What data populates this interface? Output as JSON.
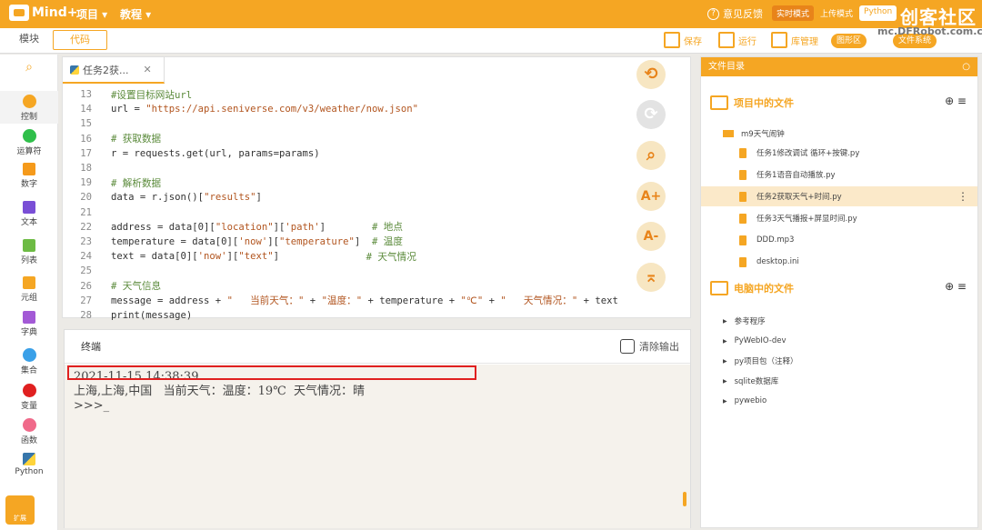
{
  "app": {
    "logo": "Mind+",
    "menu_project": "项目 ▾",
    "menu_tutorial": "教程 ▾",
    "feedback": "意见反馈",
    "modes": [
      "实时模式",
      "上传模式",
      "Python"
    ],
    "brand": "创客社区",
    "site": "mc.DFRobot.com.cn"
  },
  "toolbar": {
    "tab_blocks": "模块",
    "tab_code": "代码",
    "save": "保存",
    "run": "运行",
    "lib": "库管理",
    "graph": "图形区",
    "fs": "文件系统"
  },
  "sidebar": [
    "控制",
    "运算符",
    "数字",
    "文本",
    "列表",
    "元组",
    "字典",
    "集合",
    "变量",
    "函数",
    "Python",
    "扩展"
  ],
  "sidebar_colors": [
    "#f5a623",
    "#2fbf4a",
    "#f59a1b",
    "#7a4fd6",
    "#6dbb44",
    "#f5a623",
    "#a35ad6",
    "#3aa0e8",
    "#e02020",
    "#f06a8a",
    "#3776ab"
  ],
  "editor": {
    "file_tab": "任务2获...",
    "lines": [
      {
        "n": "13",
        "t": [
          [
            "cm",
            "#设置目标网站url"
          ]
        ]
      },
      {
        "n": "14",
        "t": [
          [
            "",
            "url = "
          ],
          [
            "st",
            "\"https://api.seniverse.com/v3/weather/now.json\""
          ]
        ]
      },
      {
        "n": "15",
        "t": []
      },
      {
        "n": "16",
        "t": [
          [
            "cm",
            "# 获取数据"
          ]
        ]
      },
      {
        "n": "17",
        "t": [
          [
            "",
            "r = requests.get(url, params=params)"
          ]
        ]
      },
      {
        "n": "18",
        "t": []
      },
      {
        "n": "19",
        "t": [
          [
            "cm",
            "# 解析数据"
          ]
        ]
      },
      {
        "n": "20",
        "t": [
          [
            "",
            "data = r.json()["
          ],
          [
            "st",
            "\"results\""
          ],
          [
            "",
            "]"
          ]
        ]
      },
      {
        "n": "21",
        "t": []
      },
      {
        "n": "22",
        "t": [
          [
            "",
            "address = data[0]["
          ],
          [
            "st",
            "\"location\""
          ],
          [
            "",
            "]["
          ],
          [
            "st",
            "'path'"
          ],
          [
            "",
            "]        "
          ],
          [
            "cm",
            "# 地点"
          ]
        ]
      },
      {
        "n": "23",
        "t": [
          [
            "",
            "temperature = data[0]["
          ],
          [
            "st",
            "'now'"
          ],
          [
            "",
            "]["
          ],
          [
            "st",
            "\"temperature\""
          ],
          [
            "",
            "]  "
          ],
          [
            "cm",
            "# 温度"
          ]
        ]
      },
      {
        "n": "24",
        "t": [
          [
            "",
            "text = data[0]["
          ],
          [
            "st",
            "'now'"
          ],
          [
            "",
            "]["
          ],
          [
            "st",
            "\"text\""
          ],
          [
            "",
            "]               "
          ],
          [
            "cm",
            "# 天气情况"
          ]
        ]
      },
      {
        "n": "25",
        "t": []
      },
      {
        "n": "26",
        "t": [
          [
            "cm",
            "# 天气信息"
          ]
        ]
      },
      {
        "n": "27",
        "t": [
          [
            "",
            "message = address + "
          ],
          [
            "st",
            "\"   当前天气：\""
          ],
          [
            "",
            " + "
          ],
          [
            "st",
            "\"温度：\""
          ],
          [
            "",
            ""
          ],
          [
            "",
            ""
          ],
          [
            "",
            " + temperature + "
          ],
          [
            "st",
            "\"℃\""
          ],
          [
            "",
            " + "
          ],
          [
            "st",
            "\"   天气情况：\""
          ],
          [
            "",
            " + text"
          ]
        ]
      },
      {
        "n": "28",
        "t": [
          [
            "",
            "print(message)"
          ]
        ]
      }
    ],
    "floats": [
      "⟲",
      "⟳",
      "⌕",
      "A+",
      "A-",
      "⌅"
    ]
  },
  "terminal": {
    "title": "终端",
    "clear": "清除输出",
    "lines": [
      "2021-11-15 14:38:39",
      "上海,上海,中国   当前天气：温度：19℃  天气情况：晴",
      ">>>_"
    ]
  },
  "files": {
    "header": "文件目录",
    "project_title": "项目中的文件",
    "folder": "m9天气闹钟",
    "project_files": [
      "任务1修改调试 循环+按键.py",
      "任务1语音自动播放.py",
      "任务2获取天气+时间.py",
      "任务3天气播报+屏显时间.py",
      "DDD.mp3",
      "desktop.ini"
    ],
    "selected": 2,
    "computer_title": "电脑中的文件",
    "computer_folders": [
      "参考程序",
      "PyWebIO-dev",
      "py项目包（注释）",
      "sqlite数据库",
      "pywebio"
    ]
  }
}
